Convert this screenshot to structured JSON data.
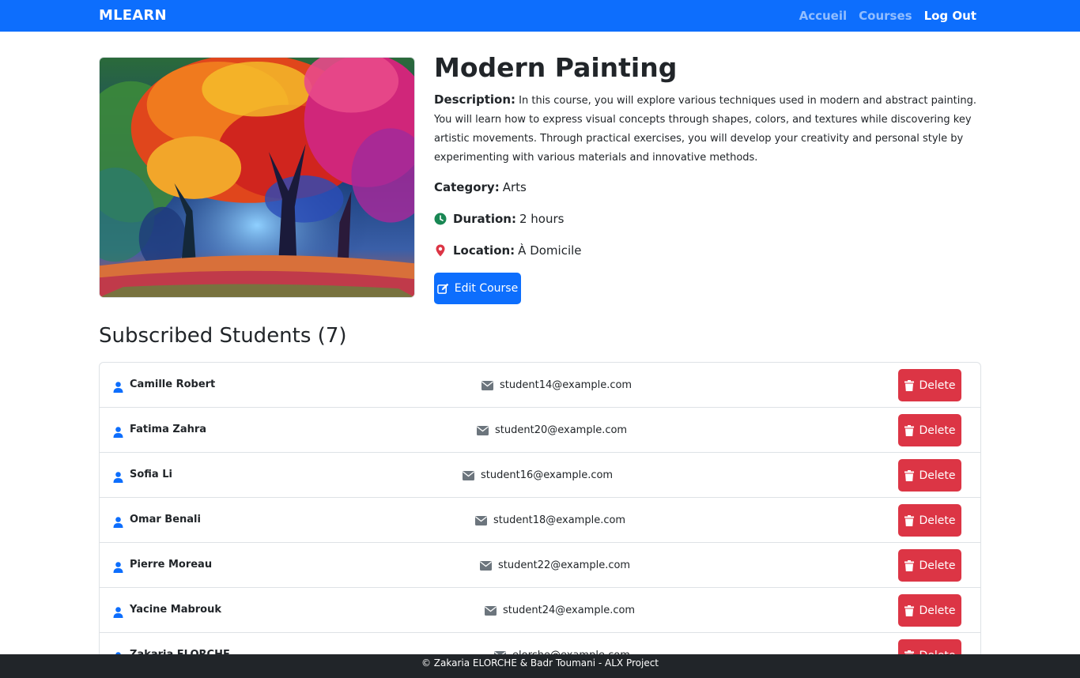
{
  "navbar": {
    "brand": "MLEARN",
    "links": [
      "Accueil",
      "Courses",
      "Log Out"
    ]
  },
  "course": {
    "title": "Modern Painting",
    "description_label": "Description:",
    "description": "In this course, you will explore various techniques used in modern and abstract painting. You will learn how to express visual concepts through shapes, colors, and textures while discovering key artistic movements. Through practical exercises, you will develop your creativity and personal style by experimenting with various materials and innovative methods.",
    "category_label": "Category:",
    "category": "Arts",
    "duration_label": "Duration:",
    "duration": "2 hours",
    "location_label": "Location:",
    "location": "À Domicile",
    "edit_button": "Edit Course"
  },
  "students": {
    "heading": "Subscribed Students (7)",
    "delete_label": "Delete",
    "items": [
      {
        "name": "Camille Robert",
        "email": "student14@example.com"
      },
      {
        "name": "Fatima Zahra",
        "email": "student20@example.com"
      },
      {
        "name": "Sofia Li",
        "email": "student16@example.com"
      },
      {
        "name": "Omar Benali",
        "email": "student18@example.com"
      },
      {
        "name": "Pierre Moreau",
        "email": "student22@example.com"
      },
      {
        "name": "Yacine Mabrouk",
        "email": "student24@example.com"
      },
      {
        "name": "Zakaria ELORCHE",
        "email": "elorche@example.com"
      }
    ]
  },
  "footer": {
    "text": "© Zakaria ELORCHE & Badr Toumani - ALX Project"
  },
  "colors": {
    "primary": "#0d6efd",
    "danger": "#dc3545",
    "success": "#198754",
    "dark": "#212529"
  },
  "icons": {
    "duration": "clock-icon",
    "location": "map-pin-icon",
    "edit": "edit-icon",
    "user": "user-icon",
    "email": "envelope-icon",
    "delete": "trash-icon"
  }
}
